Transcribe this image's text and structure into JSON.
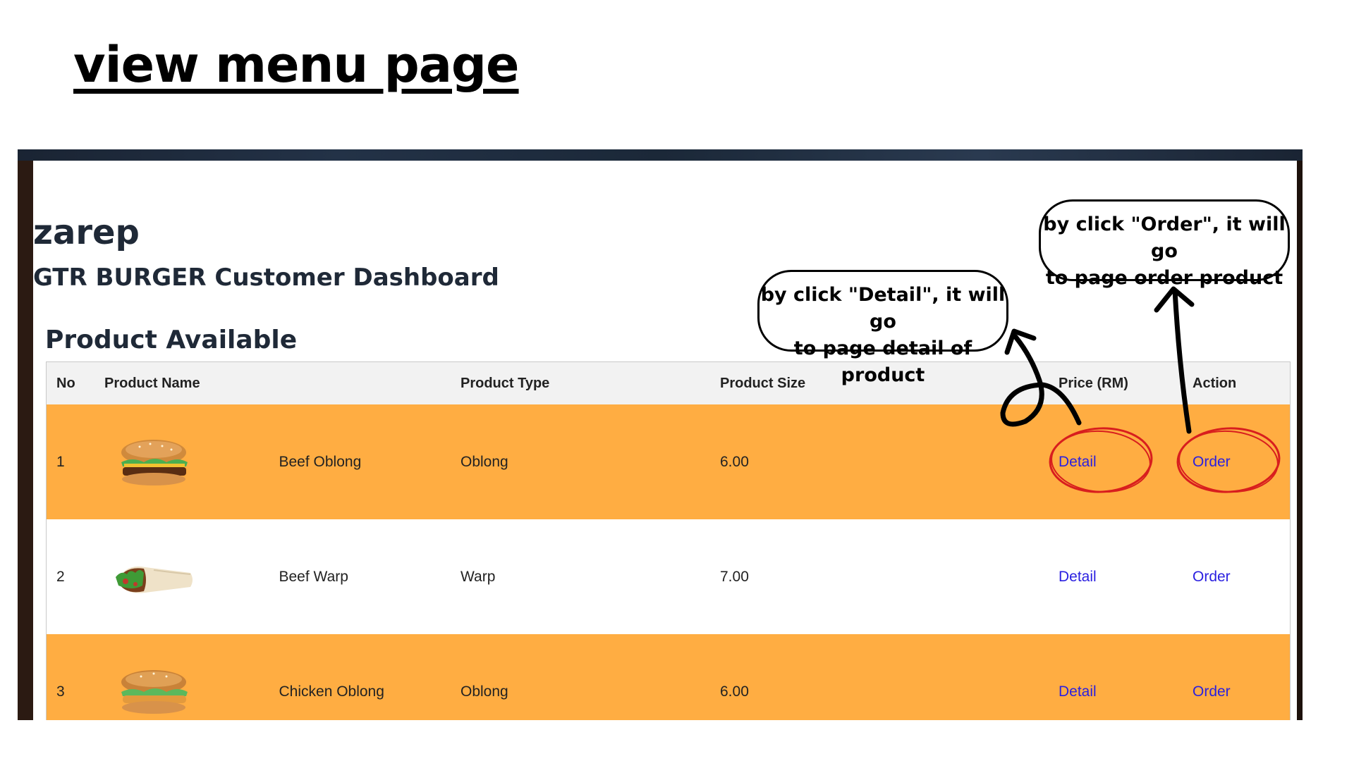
{
  "slide": {
    "heading": "view menu page"
  },
  "dashboard": {
    "user_name": "zarep",
    "title": "GTR BURGER Customer Dashboard",
    "section_title": "Product Available"
  },
  "table": {
    "columns": [
      "No",
      "Product Name",
      "Product Type",
      "Product Size",
      "Price (RM)",
      "Action"
    ],
    "rows": [
      {
        "no": "1",
        "image": "burger-image",
        "name": "Beef Oblong",
        "type": "Oblong",
        "size": "6.00",
        "detail": "Detail",
        "order": "Order"
      },
      {
        "no": "2",
        "image": "wrap-image",
        "name": "Beef Warp",
        "type": "Warp",
        "size": "7.00",
        "detail": "Detail",
        "order": "Order"
      },
      {
        "no": "3",
        "image": "burger-image",
        "name": "Chicken Oblong",
        "type": "Oblong",
        "size": "6.00",
        "detail": "Detail",
        "order": "Order"
      }
    ]
  },
  "callouts": {
    "detail": {
      "line1": "by click \"Detail\", it will go",
      "line2": "to page detail of product"
    },
    "order": {
      "line1": "by click \"Order\", it will go",
      "line2": "to page order product"
    }
  },
  "colors": {
    "row_highlight": "#ffad42",
    "link": "#2a1fe0",
    "annotation_circle": "#d81e1e",
    "header_bg": "#f2f2f2"
  }
}
